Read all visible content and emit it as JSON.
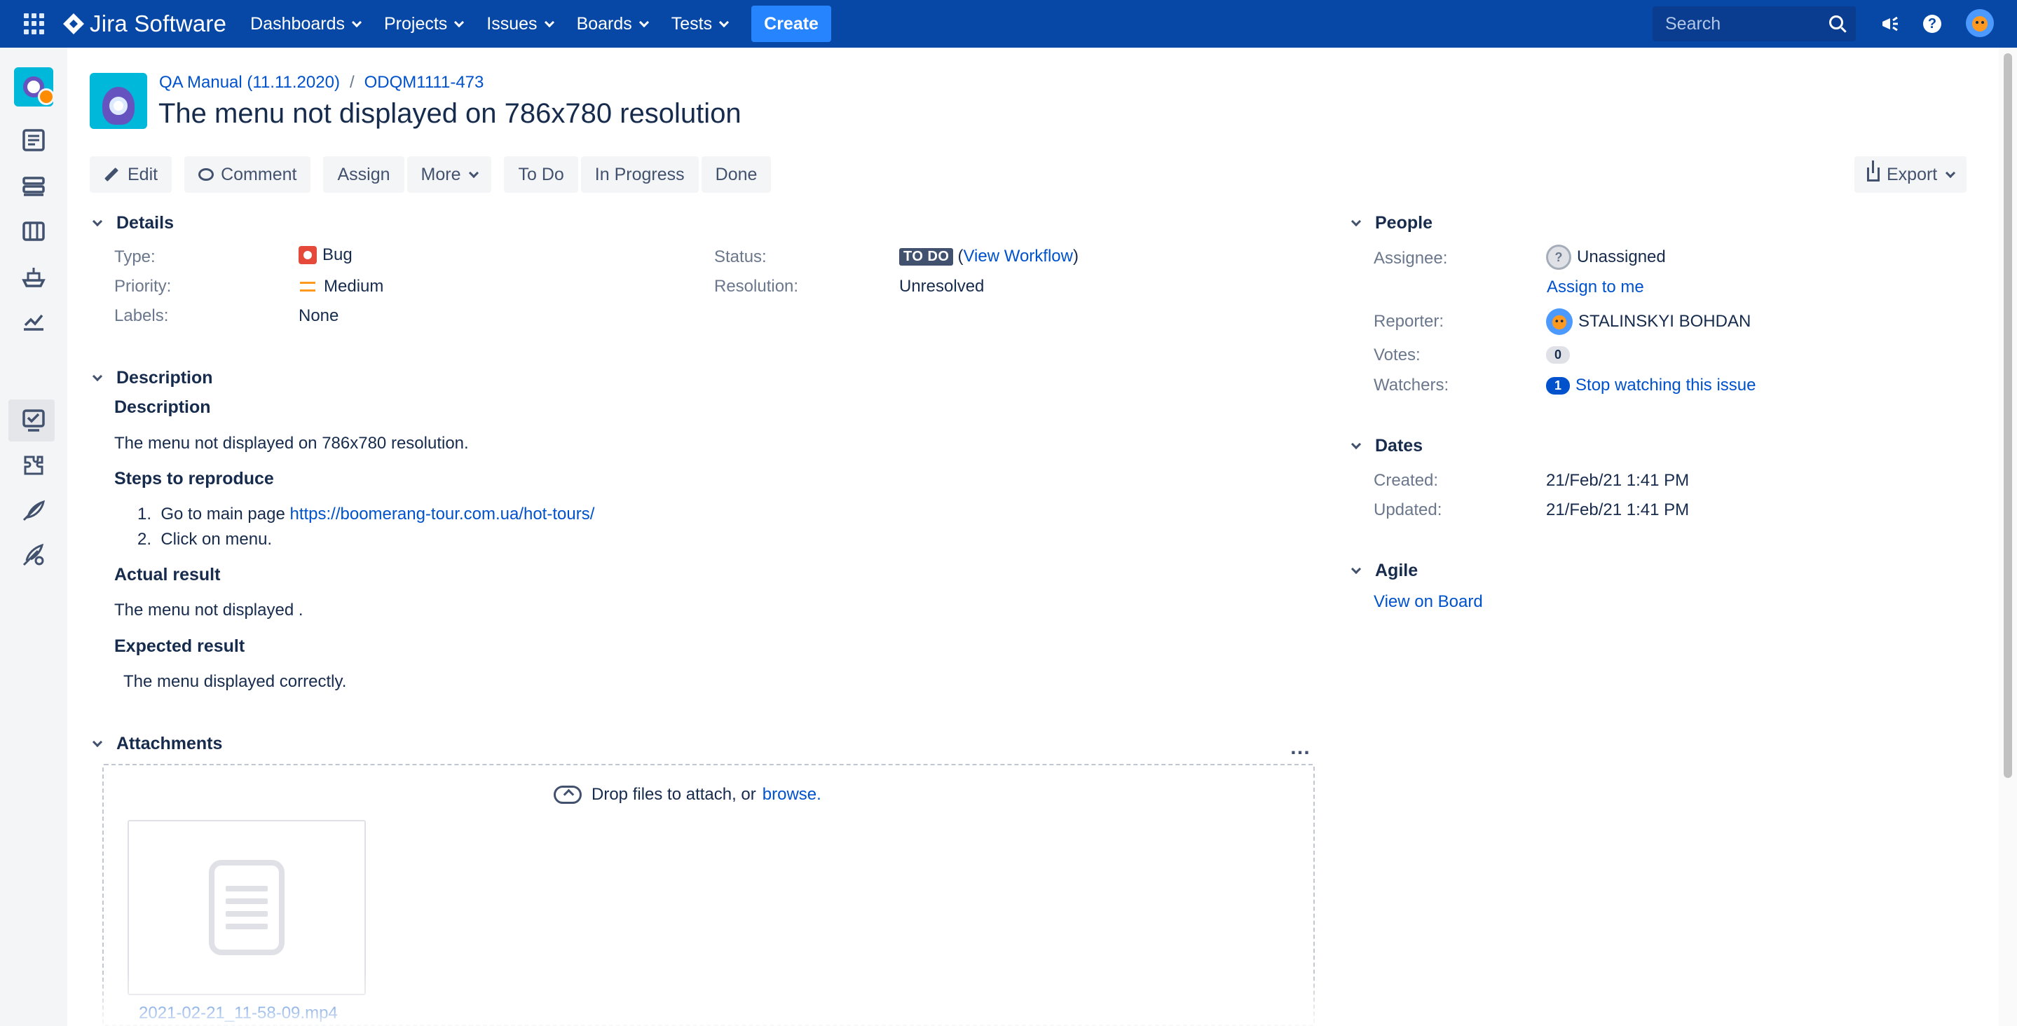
{
  "topnav": {
    "logo_text": "Jira Software",
    "menu": [
      "Dashboards",
      "Projects",
      "Issues",
      "Boards",
      "Tests"
    ],
    "create_label": "Create",
    "search_placeholder": "Search"
  },
  "breadcrumb": {
    "project": "QA Manual (11.11.2020)",
    "separator": "/",
    "issue_key": "ODQM1111-473"
  },
  "title": "The menu not displayed on 786x780 resolution",
  "toolbar": {
    "edit": "Edit",
    "comment": "Comment",
    "assign": "Assign",
    "more": "More",
    "todo": "To Do",
    "in_progress": "In Progress",
    "done": "Done",
    "export": "Export"
  },
  "details": {
    "heading": "Details",
    "type_label": "Type:",
    "type_value": "Bug",
    "priority_label": "Priority:",
    "priority_value": "Medium",
    "labels_label": "Labels:",
    "labels_value": "None",
    "status_label": "Status:",
    "status_value": "TO DO",
    "workflow_open": "(",
    "workflow_link": "View Workflow",
    "workflow_close": ")",
    "resolution_label": "Resolution:",
    "resolution_value": "Unresolved"
  },
  "description": {
    "heading": "Description",
    "sub_heading": "Description",
    "summary": "The menu not displayed on 786x780 resolution.",
    "steps_heading": "Steps to reproduce",
    "step1_prefix": "1.  Go to main page ",
    "step1_link": "https://boomerang-tour.com.ua/hot-tours/",
    "step2": "2.  Click on menu.",
    "actual_heading": "Actual result",
    "actual_text": "The menu not displayed .",
    "expected_heading": "Expected result",
    "expected_text": "The menu displayed correctly."
  },
  "attachments": {
    "heading": "Attachments",
    "more_icon": "…",
    "drop_text": "Drop files to attach, or",
    "browse": "browse.",
    "file_name": "2021-02-21_11-58-09.mp4"
  },
  "people": {
    "heading": "People",
    "assignee_label": "Assignee:",
    "assignee_value": "Unassigned",
    "assign_to_me": "Assign to me",
    "reporter_label": "Reporter:",
    "reporter_value": "STALINSKYI BOHDAN",
    "votes_label": "Votes:",
    "votes_value": "0",
    "watchers_label": "Watchers:",
    "watchers_count": "1",
    "watchers_link": "Stop watching this issue"
  },
  "dates": {
    "heading": "Dates",
    "created_label": "Created:",
    "created_value": "21/Feb/21 1:41 PM",
    "updated_label": "Updated:",
    "updated_value": "21/Feb/21 1:41 PM"
  },
  "agile": {
    "heading": "Agile",
    "link": "View on Board"
  },
  "colors": {
    "nav_bg": "#0747a6",
    "create_bg": "#2684ff",
    "link": "#0052cc",
    "bug": "#e5493a",
    "priority_medium": "#ff991f",
    "status_todo": "#42526e"
  }
}
